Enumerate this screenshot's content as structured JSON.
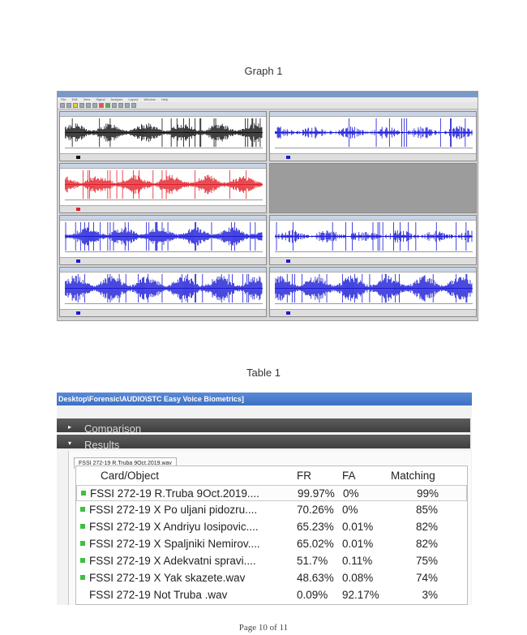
{
  "graph_caption": "Graph 1",
  "table_caption": "Table 1",
  "graph": {
    "menu_items": [
      "File",
      "Edit",
      "View",
      "Signal",
      "Analysis",
      "Layout",
      "Window",
      "Help"
    ],
    "panels": [
      {
        "id": "wave-1",
        "color": "#111111",
        "density": "medium"
      },
      {
        "id": "wave-2",
        "color": "#1a1ad6",
        "density": "sparse"
      },
      {
        "id": "wave-3",
        "color": "#e0202a",
        "density": "medium"
      },
      {
        "id": "empty",
        "color": "#9c9c9c",
        "density": "none"
      },
      {
        "id": "wave-4",
        "color": "#1a1ad6",
        "density": "medium"
      },
      {
        "id": "wave-5",
        "color": "#1a1ad6",
        "density": "sparse"
      },
      {
        "id": "wave-6",
        "color": "#1a1ad6",
        "density": "dense"
      },
      {
        "id": "wave-7",
        "color": "#1a1ad6",
        "density": "dense"
      }
    ]
  },
  "app": {
    "path": "Desktop\\Forensic\\AUDIO\\STC Easy Voice Biometrics]",
    "sections": {
      "comparison": "Comparison",
      "results": "Results"
    },
    "result_tab": "FSSI 272-19 R.Truba 9Oct.2019.wav"
  },
  "results_table": {
    "columns": [
      "Card/Object",
      "FR",
      "FA",
      "Matching"
    ],
    "rows": [
      {
        "name": "FSSI 272-19 R.Truba 9Oct.2019....",
        "fr": "99.97%",
        "fa": "0%",
        "matching": "99%",
        "marker": true,
        "selected": true
      },
      {
        "name": "FSSI 272-19 X Po uljani pidozru....",
        "fr": "70.26%",
        "fa": "0%",
        "matching": "85%",
        "marker": true,
        "selected": false
      },
      {
        "name": "FSSI 272-19 X Andriyu Iosipovic....",
        "fr": "65.23%",
        "fa": "0.01%",
        "matching": "82%",
        "marker": true,
        "selected": false
      },
      {
        "name": "FSSI 272-19 X Spaljniki Nemirov....",
        "fr": "65.02%",
        "fa": "0.01%",
        "matching": "82%",
        "marker": true,
        "selected": false
      },
      {
        "name": "FSSI 272-19 X Adekvatni spravi....",
        "fr": "51.7%",
        "fa": "0.11%",
        "matching": "75%",
        "marker": true,
        "selected": false
      },
      {
        "name": "FSSI 272-19 X Yak skazete.wav",
        "fr": "48.63%",
        "fa": "0.08%",
        "matching": "74%",
        "marker": true,
        "selected": false
      },
      {
        "name": "FSSI 272-19 Not Truba .wav",
        "fr": "0.09%",
        "fa": "92.17%",
        "matching": "3%",
        "marker": false,
        "selected": false
      }
    ]
  },
  "page_number": "Page 10 of 11"
}
